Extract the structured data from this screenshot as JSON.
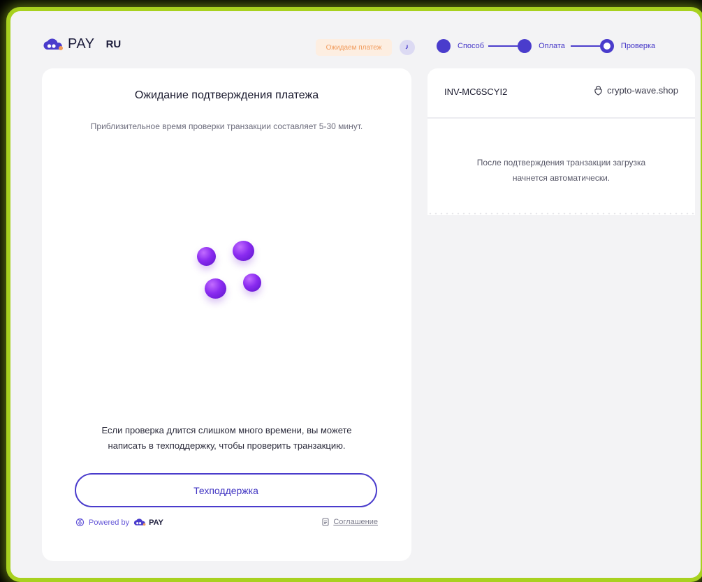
{
  "header": {
    "logo_text": "PAY",
    "language": "RU",
    "status": "Ожидаем платеж",
    "steps": [
      {
        "label": "Способ",
        "state": "done"
      },
      {
        "label": "Оплата",
        "state": "done"
      },
      {
        "label": "Проверка",
        "state": "current"
      }
    ]
  },
  "main": {
    "title": "Ожидание подтверждения платежа",
    "subtitle": "Приблизительное время проверки транзакции составляет 5-30 минут.",
    "help_line1": "Если проверка длится слишком много времени, вы можете",
    "help_line2": "написать в техподдержку, чтобы проверить транзакцию.",
    "support_button": "Техподдержка",
    "powered_by": "Powered by",
    "powered_brand": "PAY",
    "agreement_link": "Соглашение"
  },
  "invoice": {
    "id": "INV-MC6SCYI2",
    "shop": "crypto-wave.shop",
    "message_line1": "После подтверждения транзакции загрузка",
    "message_line2": "начнется автоматически."
  },
  "colors": {
    "accent": "#4a3ccc",
    "border_glow": "#a8d11f",
    "status_bg": "#fdeee1",
    "status_text": "#f19b5c",
    "loader": "#8a2bf0"
  },
  "icons": [
    "cloud-logo-icon",
    "clock-icon",
    "lock-icon",
    "support-icon",
    "document-icon"
  ]
}
